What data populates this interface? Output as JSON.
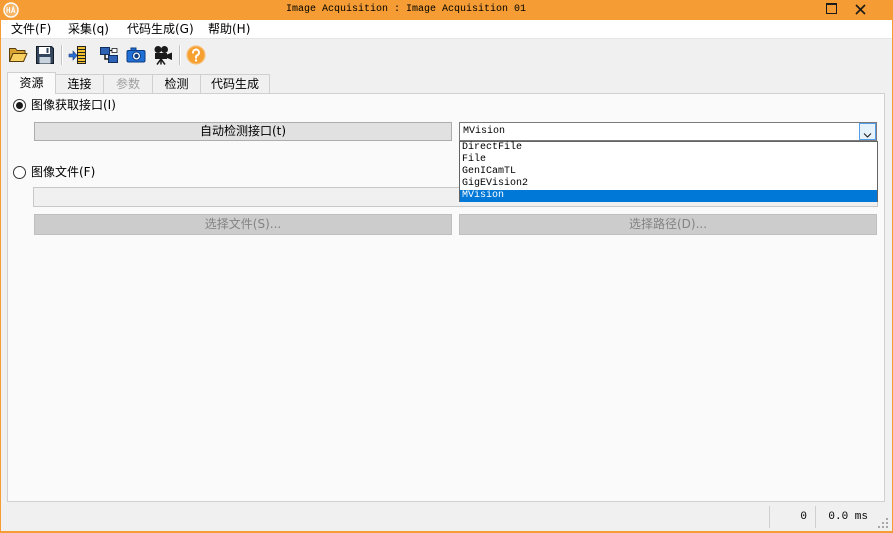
{
  "window": {
    "title": "Image Acquisition : Image Acquisition 01",
    "app_icon": "halcon-app-icon",
    "buttons": {
      "minimize": "minimize-icon",
      "maximize": "maximize-icon",
      "close": "close-icon"
    }
  },
  "menu": {
    "items": [
      {
        "label": "文件(F)"
      },
      {
        "label": "采集(q)"
      },
      {
        "label": "代码生成(G)"
      },
      {
        "label": "帮助(H)"
      }
    ]
  },
  "toolbar": {
    "icons": [
      "open-folder-icon",
      "save-icon",
      "detect-interface-icon",
      "connect-icon",
      "snap-icon",
      "live-icon",
      "help-icon"
    ]
  },
  "tabs": [
    {
      "label": "资源",
      "selected": true,
      "disabled": false
    },
    {
      "label": "连接",
      "selected": false,
      "disabled": false
    },
    {
      "label": "参数",
      "selected": false,
      "disabled": true
    },
    {
      "label": "检测",
      "selected": false,
      "disabled": false
    },
    {
      "label": "代码生成",
      "selected": false,
      "disabled": false
    }
  ],
  "resources": {
    "interface_radio": {
      "label": "图像获取接口(I)",
      "checked": true
    },
    "autodetect_button": {
      "label": "自动检测接口(t)",
      "enabled": true
    },
    "interface_combo": {
      "value": "MVision",
      "open": true,
      "options": [
        "DirectFile",
        "File",
        "GenICamTL",
        "GigEVision2",
        "MVision"
      ],
      "selected_index": 4
    },
    "file_radio": {
      "label": "图像文件(F)",
      "checked": false
    },
    "file_input": {
      "value": "",
      "enabled": false
    },
    "select_file_button": {
      "label": "选择文件(S)...",
      "enabled": false
    },
    "select_path_button": {
      "label": "选择路径(D)...",
      "enabled": false
    }
  },
  "statusbar": {
    "count": "0",
    "time": "0.0 ms"
  },
  "colors": {
    "titlebar": "#f59d34",
    "selection": "#0078d7",
    "disabled_text": "#838383",
    "button_face": "#e1e1e1"
  }
}
